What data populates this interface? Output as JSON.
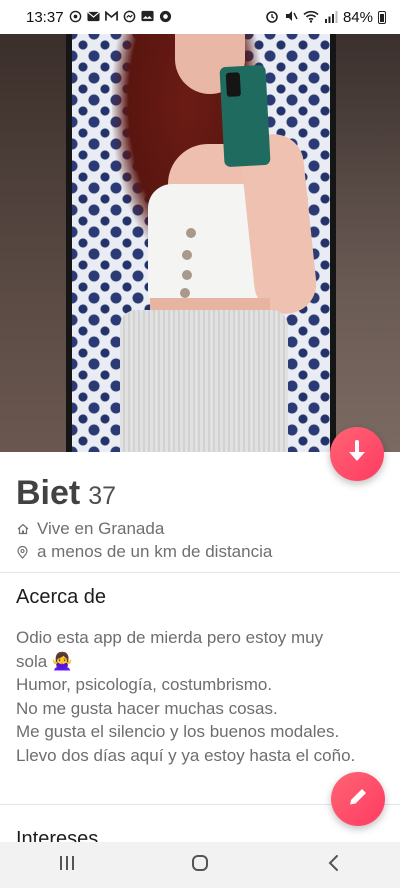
{
  "status_bar": {
    "time": "13:37",
    "battery": "84%",
    "left_icons": [
      "whatsapp-icon",
      "mail-icon",
      "gmail-icon",
      "messenger-icon",
      "image-icon",
      "vpn-icon"
    ],
    "right_icons": [
      "alarm-icon",
      "mute-icon",
      "wifi-icon",
      "signal-icon",
      "battery-icon"
    ]
  },
  "profile": {
    "name": "Biet",
    "age": "37",
    "lives_in": "Vive en Granada",
    "distance": "a menos de un km de distancia"
  },
  "about": {
    "title": "Acerca de",
    "lines": [
      "Odio esta app de mierda pero estoy muy",
      "sola 🙅‍♀️",
      "Humor, psicología, costumbrismo.",
      "No me gusta hacer muchas cosas.",
      "Me gusta el silencio y los buenos modales.",
      "Llevo dos días aquí y ya estoy hasta el coño."
    ]
  },
  "next_section": {
    "title": "Intereses"
  },
  "colors": {
    "accent": "#ff4d6d",
    "text_primary": "#424242",
    "text_secondary": "#6e6e6e"
  },
  "nav": {
    "icons": [
      "recents-icon",
      "home-icon",
      "back-icon"
    ]
  }
}
